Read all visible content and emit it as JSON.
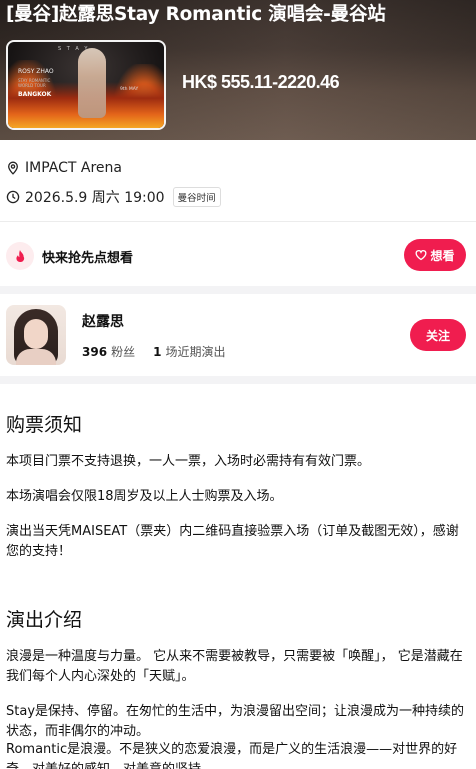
{
  "header": {
    "title": "[曼谷]赵露思Stay Romantic 演唱会-曼谷站",
    "price": "HK$ 555.11-2220.46"
  },
  "poster": {
    "brand": "S T A Y",
    "name": "ROSY ZHAO",
    "subtitle": "STAY ROMANTIC WORLD TOUR",
    "city": "BANGKOK",
    "date": "9th MAY"
  },
  "event": {
    "venue": "IMPACT Arena",
    "datetime": "2026.5.9 周六 19:00",
    "timezone_badge": "曼谷时间"
  },
  "want": {
    "prompt": "快来抢先点想看",
    "button_label": "想看"
  },
  "artist": {
    "name": "赵露思",
    "fans_count": "396",
    "fans_label": "粉丝",
    "shows_count": "1",
    "shows_label": "场近期演出",
    "follow_label": "关注"
  },
  "notice": {
    "title": "购票须知",
    "items": [
      "本项目门票不支持退换，一人一票，入场时必需持有有效门票。",
      "本场演唱会仅限18周岁及以上人士购票及入场。",
      "演出当天凭MAISEAT（票夹）内二维码直接验票入场（订单及截图无效），感谢您的支持！"
    ]
  },
  "intro": {
    "title": "演出介绍",
    "paragraphs": [
      "浪漫是一种温度与力量。 它从来不需要被教导，只需要被「唤醒」， 它是潜藏在我们每个人内心深处的「天赋」。",
      "Stay是保持、停留。在匆忙的生活中，为浪漫留出空间；让浪漫成为一种持续的状态，而非偶尔的冲动。",
      "Romantic是浪漫。不是狭义的恋爱浪漫，而是广义的生活浪漫——对世界的好奇、对美好的感知、对美意的坚持。"
    ]
  },
  "colors": {
    "accent": "#f01d4f",
    "divider": "#f3f3f5"
  },
  "icons": {
    "venue": "location-pin-icon",
    "time": "clock-icon",
    "fire": "fire-icon",
    "heart": "heart-icon"
  }
}
